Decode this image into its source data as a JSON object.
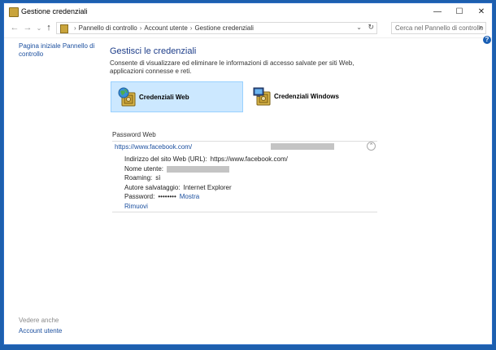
{
  "window": {
    "title": "Gestione credenziali",
    "controls": {
      "minimize": "—",
      "maximize": "☐",
      "close": "✕"
    }
  },
  "toolbar": {
    "back": "←",
    "forward": "→",
    "dropdown": "⌄",
    "up": "↑",
    "breadcrumbs": [
      "Pannello di controllo",
      "Account utente",
      "Gestione credenziali"
    ],
    "breadcrumb_sep": "›",
    "address_dropdown": "⌄",
    "refresh": "↻",
    "search_placeholder": "Cerca nel Pannello di controllo",
    "search_icon": "⌕",
    "help": "?"
  },
  "sidebar": {
    "home_link": "Pagina iniziale Pannello di controllo",
    "see_also_label": "Vedere anche",
    "see_also_link": "Account utente"
  },
  "main": {
    "title": "Gestisci le credenziali",
    "description": "Consente di visualizzare ed eliminare le informazioni di accesso salvate per siti Web, applicazioni connesse e reti.",
    "cards": [
      {
        "label": "Credenziali Web",
        "icon": "web-vault-icon",
        "selected": true
      },
      {
        "label": "Credenziali Windows",
        "icon": "windows-vault-icon",
        "selected": false
      }
    ]
  },
  "web_passwords": {
    "section_label": "Password Web",
    "entry": {
      "url": "https://www.facebook.com/",
      "collapse_glyph": "⌃",
      "site_label": "Indirizzo del sito Web (URL):",
      "site_value": "https://www.facebook.com/",
      "user_label": "Nome utente:",
      "roaming_label": "Roaming:",
      "roaming_value": "sì",
      "saved_by_label": "Autore salvataggio:",
      "saved_by_value": "Internet Explorer",
      "password_label": "Password:",
      "password_mask": "••••••••",
      "show_link": "Mostra",
      "remove_link": "Rimuovi"
    }
  }
}
